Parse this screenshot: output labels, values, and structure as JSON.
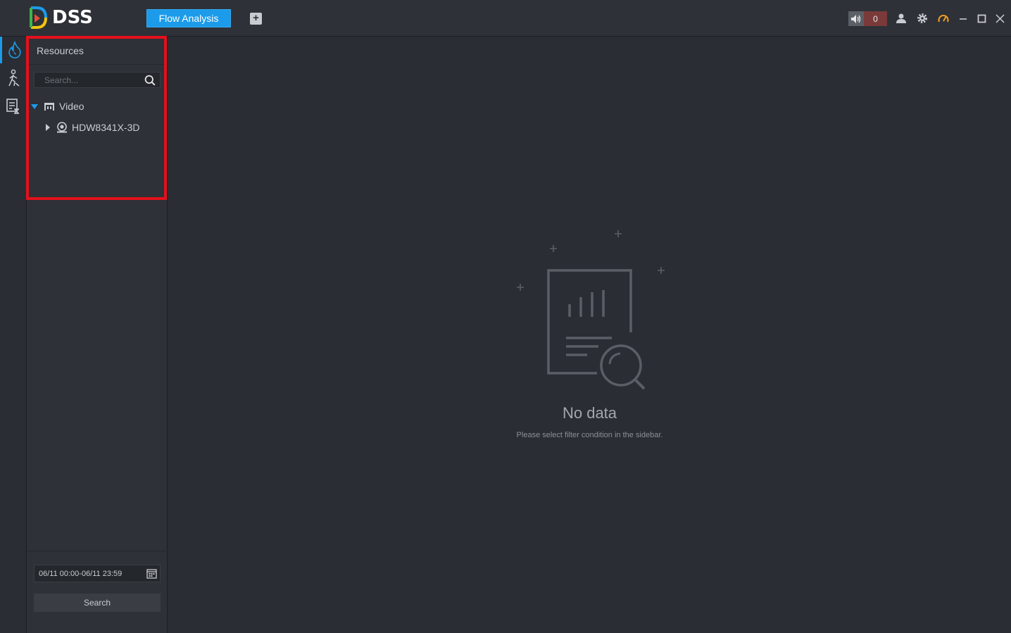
{
  "app": {
    "logo_text": "DSS",
    "tabs": [
      {
        "label": "Flow Analysis",
        "active": true
      }
    ],
    "add_tab_symbol": "+"
  },
  "header": {
    "alarm_count": "0",
    "icons": [
      "volume-icon",
      "user-icon",
      "gear-icon",
      "performance-icon",
      "minimize-icon",
      "maximize-icon",
      "close-icon"
    ]
  },
  "leftnav": {
    "items": [
      {
        "name": "heatmap-icon",
        "active": true
      },
      {
        "name": "people-flow-icon",
        "active": false
      },
      {
        "name": "report-icon",
        "active": false
      }
    ]
  },
  "sidebar": {
    "title": "Resources",
    "search_placeholder": "Search...",
    "tree": [
      {
        "label": "Video",
        "expanded": true,
        "icon": "video-group-icon"
      },
      {
        "label": "HDW8341X-3D",
        "expanded": false,
        "icon": "camera-icon"
      }
    ],
    "date_range": "06/11 00:00-06/11 23:59",
    "search_button": "Search"
  },
  "main": {
    "empty_title": "No data",
    "empty_subtitle": "Please select filter condition in the sidebar."
  },
  "colors": {
    "accent": "#1b9bea",
    "highlight": "#e3101c",
    "alarm_bg": "#7b3a3a"
  }
}
